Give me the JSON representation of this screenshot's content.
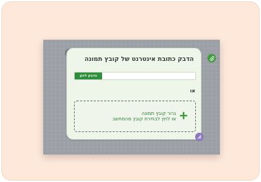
{
  "dialog": {
    "title": "הדבק כתובת אינטרנט של קובץ תמונה",
    "url_input": {
      "value": "",
      "placeholder": ""
    },
    "paste_button_label": "הדבק לינק",
    "or_label": "או",
    "drop_zone": {
      "line1": "גרור קובץ תמונה",
      "line2": "או לחץ לבחירת קובץ מהמחשב"
    }
  },
  "icons": {
    "trash": "trash-icon",
    "attach": "paperclip-icon",
    "resize": "resize-icon",
    "plus": "plus-icon"
  },
  "colors": {
    "background": "#fde8d9",
    "canvas": "#9ca0a6",
    "dialog": "#eef5e9",
    "accent_green": "#2f8e3b",
    "drop_text_green": "#2b7a35",
    "trash_gray": "#7a7c80",
    "resize_purple": "#8a79be"
  }
}
